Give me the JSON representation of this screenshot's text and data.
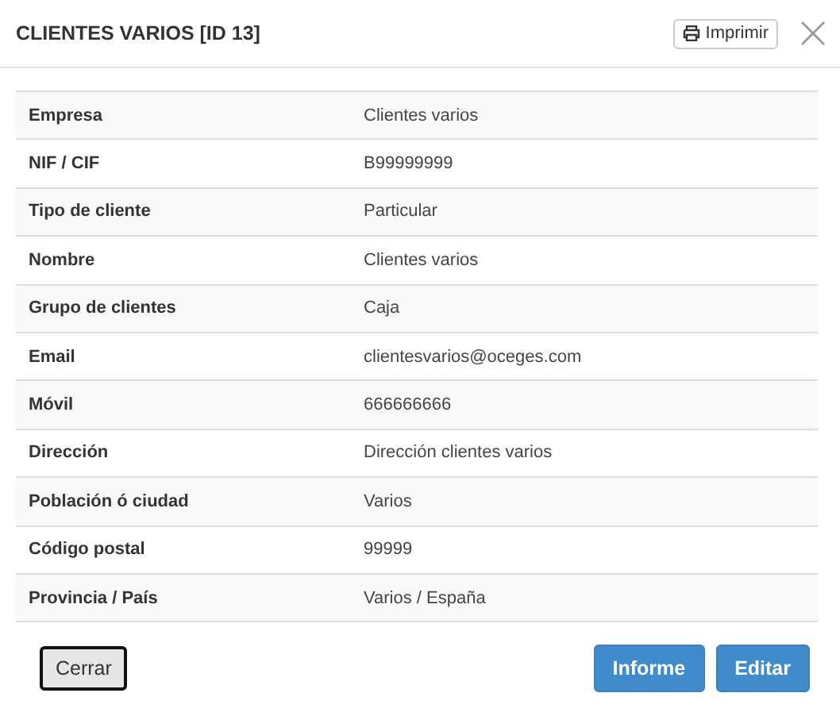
{
  "window": {
    "title": "CLIENTES VARIOS [ID 13]"
  },
  "print_button": {
    "label": "Imprimir"
  },
  "rows": [
    {
      "label": "Empresa",
      "value": "Clientes varios"
    },
    {
      "label": "NIF / CIF",
      "value": "B99999999"
    },
    {
      "label": "Tipo de cliente",
      "value": "Particular"
    },
    {
      "label": "Nombre",
      "value": "Clientes varios"
    },
    {
      "label": "Grupo de clientes",
      "value": "Caja"
    },
    {
      "label": "Email",
      "value": "clientesvarios@oceges.com"
    },
    {
      "label": "Móvil",
      "value": "666666666"
    },
    {
      "label": "Dirección",
      "value": "Dirección clientes varios"
    },
    {
      "label": "Población ó ciudad",
      "value": "Varios"
    },
    {
      "label": "Código postal",
      "value": "99999"
    },
    {
      "label": "Provincia / País",
      "value": "Varios / España"
    }
  ],
  "buttons": {
    "close": "Cerrar",
    "report": "Informe",
    "edit": "Editar"
  }
}
